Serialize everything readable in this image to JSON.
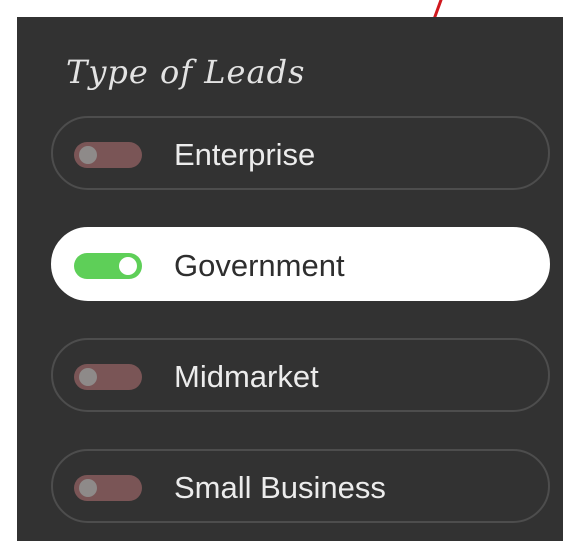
{
  "colors": {
    "panel_background": "#323232",
    "accent_line": "#d0181e",
    "toggle_on": "#5ecf58",
    "toggle_off": "#7a5556",
    "selected_background": "#ffffff"
  },
  "filter": {
    "title": "Type of Leads",
    "options": [
      {
        "label": "Enterprise",
        "selected": false,
        "icon": "toggle-off-icon"
      },
      {
        "label": "Government",
        "selected": true,
        "icon": "toggle-on-icon"
      },
      {
        "label": "Midmarket",
        "selected": false,
        "icon": "toggle-off-icon"
      },
      {
        "label": "Small Business",
        "selected": false,
        "icon": "toggle-off-icon"
      }
    ]
  }
}
